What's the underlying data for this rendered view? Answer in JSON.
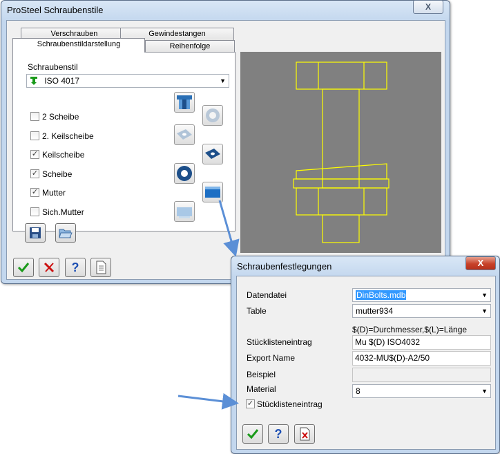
{
  "main_window": {
    "title": "ProSteel Schraubenstile",
    "close_glyph": "X",
    "tabs": [
      "Verschrauben",
      "Gewindestangen",
      "Schraubenstildarstellung",
      "Reihenfolge"
    ],
    "style_label": "Schraubenstil",
    "style_value": "ISO 4017",
    "checkboxes": [
      {
        "label": "2 Scheibe",
        "checked": false
      },
      {
        "label": "2. Keilscheibe",
        "checked": false
      },
      {
        "label": "Keilscheibe",
        "checked": true
      },
      {
        "label": "Scheibe",
        "checked": true
      },
      {
        "label": "Mutter",
        "checked": true
      },
      {
        "label": "Sich.Mutter",
        "checked": false
      }
    ],
    "icons": {
      "save": "save-icon",
      "open": "open-folder-icon",
      "ok": "checkmark-icon",
      "cancel": "cross-icon",
      "help": "question-icon",
      "report": "document-icon"
    },
    "help_glyph": "?"
  },
  "dialog": {
    "title": "Schraubenfestlegungen",
    "close_glyph": "X",
    "datendatei_label": "Datendatei",
    "datendatei_value": "DinBolts.mdb",
    "table_label": "Table",
    "table_value": "mutter934",
    "hint": "$(D)=Durchmesser,$(L)=Länge",
    "stueckliste_label": "Stücklisteneintrag",
    "stueckliste_value": "Mu $(D) ISO4032",
    "export_label": "Export Name",
    "export_value": "4032-MU$(D)-A2/50",
    "beispiel_label": "Beispiel",
    "beispiel_value": "",
    "material_label": "Material",
    "material_value": "8",
    "check_label": "Stücklisteneintrag",
    "check_checked": true,
    "help_glyph": "?"
  },
  "colors": {
    "bolt_outline": "#ffff00",
    "preview_bg": "#808080",
    "annotation_arrow": "#5b8fd6",
    "check_green": "#1a9a1a",
    "cross_red": "#cc1111",
    "help_blue": "#1d4fb3"
  }
}
